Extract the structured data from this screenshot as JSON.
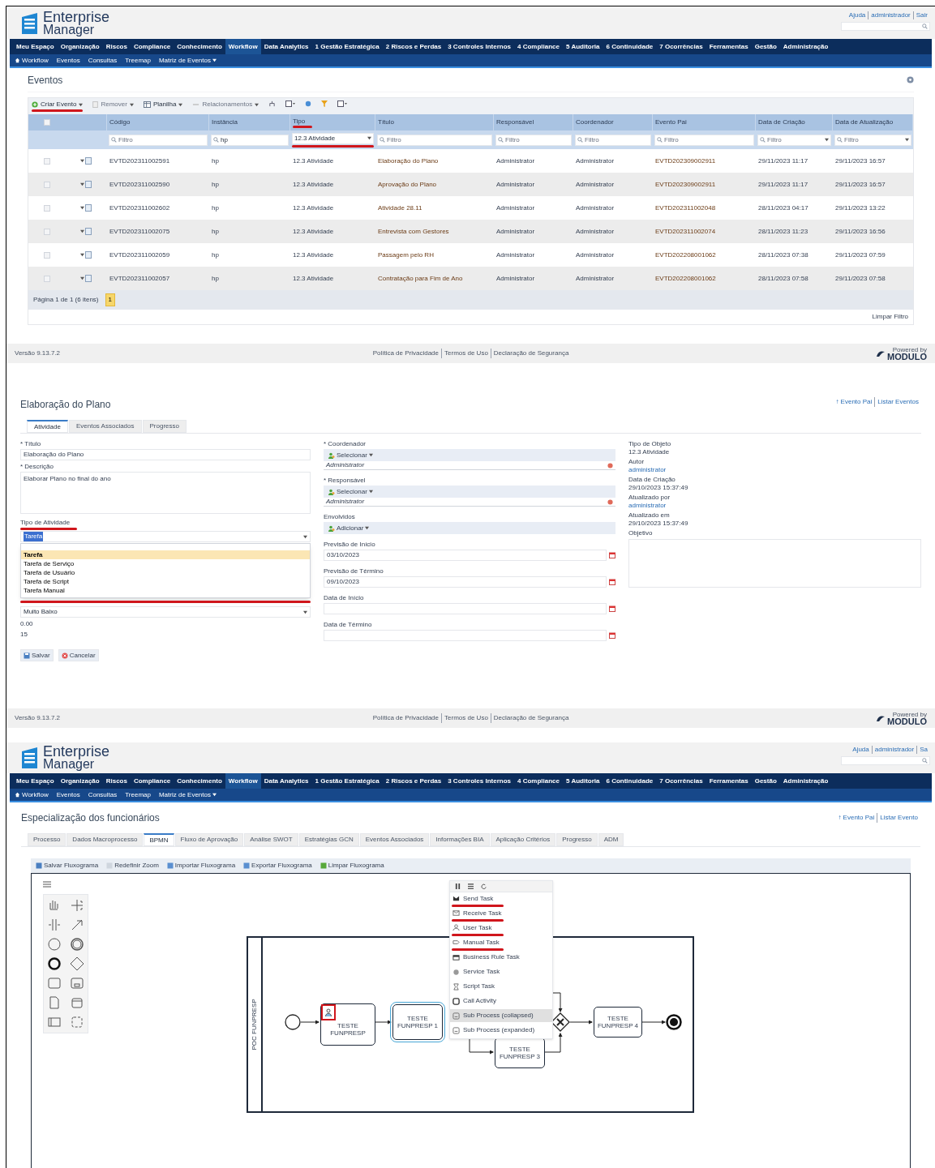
{
  "events": {
    "header": {
      "logo": [
        "Enterprise",
        "Manager"
      ],
      "top_links": [
        "Ajuda",
        "administrador",
        "Sair"
      ],
      "menu": [
        {
          "label": "Meu Espaço",
          "selected": false
        },
        {
          "label": "Organização",
          "selected": false
        },
        {
          "label": "Riscos",
          "selected": false
        },
        {
          "label": "Compliance",
          "selected": false
        },
        {
          "label": "Conhecimento",
          "selected": false
        },
        {
          "label": "Workflow",
          "selected": true
        },
        {
          "label": "Data Analytics",
          "selected": false
        },
        {
          "label": "1 Gestão Estratégica",
          "selected": false
        },
        {
          "label": "2 Riscos e Perdas",
          "selected": false
        },
        {
          "label": "3 Controles Internos",
          "selected": false
        },
        {
          "label": "4 Compliance",
          "selected": false
        },
        {
          "label": "5 Auditoria",
          "selected": false
        },
        {
          "label": "6 Continuidade",
          "selected": false
        },
        {
          "label": "7 Ocorrências",
          "selected": false
        },
        {
          "label": "Ferramentas",
          "selected": false
        },
        {
          "label": "Gestão",
          "selected": false
        },
        {
          "label": "Administração",
          "selected": false
        }
      ],
      "submenu": [
        "Workflow",
        "Eventos",
        "Consultas",
        "Treemap",
        "Matriz de Eventos"
      ]
    },
    "title": "Eventos",
    "toolbar": [
      {
        "label": "Criar Evento",
        "disabled": false,
        "annotated": true
      },
      {
        "label": "Remover",
        "disabled": true,
        "annotated": false
      },
      {
        "label": "Planilha",
        "disabled": false,
        "annotated": false
      },
      {
        "label": "Relacionamentos",
        "disabled": true,
        "annotated": false
      }
    ],
    "columns": [
      {
        "label": "Código",
        "annotated": false
      },
      {
        "label": "Instância",
        "annotated": false
      },
      {
        "label": "Tipo",
        "annotated": true
      },
      {
        "label": "Título",
        "annotated": false
      },
      {
        "label": "Responsável",
        "annotated": false
      },
      {
        "label": "Coordenador",
        "annotated": false
      },
      {
        "label": "Evento Pai",
        "annotated": false
      },
      {
        "label": "Data de Criação",
        "annotated": false
      },
      {
        "label": "Data de Atualização",
        "annotated": false
      }
    ],
    "select_all_checked": false,
    "filters": [
      {
        "kind": "text",
        "placeholder": "Filtro",
        "annotated": false
      },
      {
        "kind": "text",
        "value": "hp",
        "annotated": false
      },
      {
        "kind": "select",
        "value": "12.3 Atividade",
        "annotated": true
      },
      {
        "kind": "text",
        "placeholder": "Filtro",
        "annotated": false
      },
      {
        "kind": "text",
        "placeholder": "Filtro",
        "annotated": false
      },
      {
        "kind": "text",
        "placeholder": "Filtro",
        "annotated": false
      },
      {
        "kind": "text",
        "placeholder": "Filtro",
        "annotated": false
      },
      {
        "kind": "select",
        "placeholder": "Filtro",
        "annotated": false
      },
      {
        "kind": "select",
        "placeholder": "Filtro",
        "annotated": false
      }
    ],
    "rows": [
      {
        "checked": false,
        "cells": [
          "EVTD202311002591",
          "hp",
          "12.3 Atividade",
          "Elaboração do Plano",
          "Administrator",
          "Administrator",
          "EVTD202309002911",
          "29/11/2023 11:17",
          "29/11/2023 16:57"
        ]
      },
      {
        "checked": false,
        "cells": [
          "EVTD202311002590",
          "hp",
          "12.3 Atividade",
          "Aprovação do Plano",
          "Administrator",
          "Administrator",
          "EVTD202309002911",
          "29/11/2023 11:17",
          "29/11/2023 16:57"
        ]
      },
      {
        "checked": false,
        "cells": [
          "EVTD202311002602",
          "hp",
          "12.3 Atividade",
          "Atividade 28.11",
          "Administrator",
          "Administrator",
          "EVTD202311002048",
          "28/11/2023 04:17",
          "29/11/2023 13:22"
        ]
      },
      {
        "checked": false,
        "cells": [
          "EVTD202311002075",
          "hp",
          "12.3 Atividade",
          "Entrevista com Gestores",
          "Administrator",
          "Administrator",
          "EVTD202311002074",
          "28/11/2023 11:23",
          "29/11/2023 16:56"
        ]
      },
      {
        "checked": false,
        "cells": [
          "EVTD202311002059",
          "hp",
          "12.3 Atividade",
          "Passagem pelo RH",
          "Administrator",
          "Administrator",
          "EVTD202208001062",
          "28/11/2023 07:38",
          "29/11/2023 07:59"
        ]
      },
      {
        "checked": false,
        "cells": [
          "EVTD202311002057",
          "hp",
          "12.3 Atividade",
          "Contratação para Fim de Ano",
          "Administrator",
          "Administrator",
          "EVTD202208001062",
          "28/11/2023 07:58",
          "29/11/2023 07:58"
        ]
      }
    ],
    "pager": "Página 1 de 1 (6 itens)",
    "page": "1",
    "clear_filter": "Limpar Filtro",
    "footer": {
      "version": "Versão 9.13.7.2",
      "links": [
        "Política de Privacidade",
        "Termos de Uso",
        "Declaração de Segurança"
      ],
      "powered": "Powered by",
      "brand": "MODULO"
    }
  },
  "activity_form": {
    "title": "Elaboração do Plano",
    "top_links": [
      "↑ Evento Pai",
      "Listar Eventos"
    ],
    "tabs": [
      {
        "label": "Atividade",
        "selected": true
      },
      {
        "label": "Eventos Associados",
        "selected": false
      },
      {
        "label": "Progresso",
        "selected": false
      }
    ],
    "left_fields": [
      {
        "kind": "text",
        "label": "* Título",
        "value": "Elaboração do Plano"
      },
      {
        "kind": "textarea",
        "label": "* Descrição",
        "value": "Elaborar Plano no final do ano"
      },
      {
        "kind": "select",
        "label": "Tipo de Atividade",
        "value": "Tarefa",
        "annotated": true,
        "open": true,
        "options": [
          {
            "label": "Tarefa",
            "selected": true
          },
          {
            "label": "Tarefa de Serviço",
            "selected": false
          },
          {
            "label": "Tarefa de Usuário",
            "selected": false
          },
          {
            "label": "Tarefa de Script",
            "selected": false
          },
          {
            "label": "Tarefa Manual",
            "selected": false
          }
        ]
      },
      {
        "kind": "select",
        "value": "Muito Baixo",
        "annotated": false,
        "open": false
      },
      {
        "kind": "static",
        "value": "0.00"
      },
      {
        "kind": "static",
        "value": "15"
      }
    ],
    "middle_fields": [
      {
        "kind": "picker",
        "label": "* Coordenador",
        "button": "Selecionar",
        "value": "Administrator"
      },
      {
        "kind": "picker",
        "label": "* Responsável",
        "button": "Selecionar",
        "value": "Administrator"
      },
      {
        "kind": "picker",
        "label": "Envolvidos",
        "button": "Adicionar"
      },
      {
        "kind": "date",
        "label": "Previsão de Início",
        "value": "03/10/2023"
      },
      {
        "kind": "date",
        "label": "Previsão de Término",
        "value": "09/10/2023"
      },
      {
        "kind": "date",
        "label": "Data de Início"
      },
      {
        "kind": "date",
        "label": "Data de Término"
      }
    ],
    "info": [
      {
        "label": "Tipo de Objeto",
        "value": "12.3 Atividade",
        "link": false
      },
      {
        "label": "Autor",
        "value": "administrator",
        "link": true
      },
      {
        "label": "Data de Criação",
        "value": "29/10/2023 15:37:49",
        "link": false
      },
      {
        "label": "Atualizado por",
        "value": "administrator",
        "link": true
      },
      {
        "label": "Atualizado em",
        "value": "29/10/2023 15:37:49",
        "link": false
      }
    ],
    "objective_label": "Objetivo",
    "buttons": [
      "Salvar",
      "Cancelar"
    ],
    "footer": {
      "version": "Versão 9.13.7.2",
      "links": [
        "Política de Privacidade",
        "Termos de Uso",
        "Declaração de Segurança"
      ],
      "powered": "Powered by",
      "brand": "MODULO"
    }
  },
  "bpmn_editor": {
    "header": {
      "logo": [
        "Enterprise",
        "Manager"
      ],
      "top_links": [
        "Ajuda",
        "administrador",
        "Sa"
      ],
      "menu": [
        {
          "label": "Meu Espaço",
          "selected": false
        },
        {
          "label": "Organização",
          "selected": false
        },
        {
          "label": "Riscos",
          "selected": false
        },
        {
          "label": "Compliance",
          "selected": false
        },
        {
          "label": "Conhecimento",
          "selected": false
        },
        {
          "label": "Workflow",
          "selected": true
        },
        {
          "label": "Data Analytics",
          "selected": false
        },
        {
          "label": "1 Gestão Estratégica",
          "selected": false
        },
        {
          "label": "2 Riscos e Perdas",
          "selected": false
        },
        {
          "label": "3 Controles Internos",
          "selected": false
        },
        {
          "label": "4 Compliance",
          "selected": false
        },
        {
          "label": "5 Auditoria",
          "selected": false
        },
        {
          "label": "6 Continuidade",
          "selected": false
        },
        {
          "label": "7 Ocorrências",
          "selected": false
        },
        {
          "label": "Ferramentas",
          "selected": false
        },
        {
          "label": "Gestão",
          "selected": false
        },
        {
          "label": "Administração",
          "selected": false
        }
      ],
      "submenu": [
        "Workflow",
        "Eventos",
        "Consultas",
        "Treemap",
        "Matriz de Eventos"
      ]
    },
    "title": "Especialização dos funcionários",
    "top_links": [
      "↑ Evento Pai",
      "Listar Evento"
    ],
    "tabs": [
      {
        "label": "Processo",
        "selected": false
      },
      {
        "label": "Dados Macroprocesso",
        "selected": false
      },
      {
        "label": "BPMN",
        "selected": true
      },
      {
        "label": "Fluxo de Aprovação",
        "selected": false
      },
      {
        "label": "Análise SWOT",
        "selected": false
      },
      {
        "label": "Estratégias GCN",
        "selected": false
      },
      {
        "label": "Eventos Associados",
        "selected": false
      },
      {
        "label": "Informações BIA",
        "selected": false
      },
      {
        "label": "Aplicação Critérios",
        "selected": false
      },
      {
        "label": "Progresso",
        "selected": false
      },
      {
        "label": "ADM",
        "selected": false
      }
    ],
    "toolbar": [
      "Salvar Fluxograma",
      "Redefinir Zoom",
      "Importar Fluxograma",
      "Exportar Fluxograma",
      "Limpar Fluxograma"
    ],
    "pool": "POC FUNPRESP",
    "tasks": [
      {
        "kind": "user",
        "label": "TESTE FUNPRESP",
        "selected": false,
        "annotated": true
      },
      {
        "kind": "plain",
        "label": "TESTE FUNPRESP 1",
        "selected": true,
        "annotated": false
      },
      {
        "kind": "plain",
        "label": "TESTE FUNPRESP 3",
        "selected": false,
        "annotated": false
      },
      {
        "kind": "plain",
        "label": "TESTE FUNPRESP 4",
        "selected": false,
        "annotated": false
      }
    ],
    "context_menu": [
      {
        "label": "Send Task",
        "selected": false,
        "annotated": true
      },
      {
        "label": "Receive Task",
        "selected": false,
        "annotated": true
      },
      {
        "label": "User Task",
        "selected": false,
        "annotated": true
      },
      {
        "label": "Manual Task",
        "selected": false,
        "annotated": true
      },
      {
        "label": "Business Rule Task",
        "selected": false,
        "annotated": false
      },
      {
        "label": "Service Task",
        "selected": false,
        "annotated": false
      },
      {
        "label": "Script Task",
        "selected": false,
        "annotated": false
      },
      {
        "label": "Call Activity",
        "selected": false,
        "annotated": false
      },
      {
        "label": "Sub Process (collapsed)",
        "selected": true,
        "annotated": false
      },
      {
        "label": "Sub Process (expanded)",
        "selected": false,
        "annotated": false
      }
    ]
  }
}
